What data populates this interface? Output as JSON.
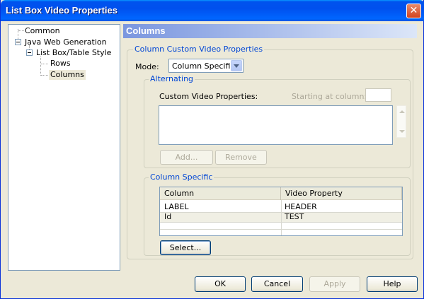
{
  "window": {
    "title": "List Box Video Properties",
    "close_glyph": "✕"
  },
  "tree": {
    "items": [
      {
        "label": "Common"
      },
      {
        "label": "Java Web Generation"
      },
      {
        "label": "List Box/Table Style"
      },
      {
        "label": "Rows"
      },
      {
        "label": "Columns",
        "selected": true
      }
    ]
  },
  "panel": {
    "title": "Columns",
    "custom_group": {
      "legend": "Column Custom Video Properties",
      "mode_label": "Mode:",
      "mode_value": "Column Specific",
      "alternating": {
        "legend": "Alternating",
        "custom_label": "Custom Video Properties:",
        "starting_label": "Starting at column:",
        "add_button": "Add...",
        "remove_button": "Remove"
      },
      "column_specific": {
        "legend": "Column Specific",
        "columns": [
          "Column",
          "Video Property"
        ],
        "rows": [
          [
            "LABEL",
            "HEADER"
          ],
          [
            "Id",
            "TEST"
          ]
        ],
        "select_button": "Select..."
      }
    }
  },
  "footer": {
    "ok": "OK",
    "cancel": "Cancel",
    "apply": "Apply",
    "help": "Help"
  },
  "colors": {
    "titlebar": "#0054e3",
    "group_label": "#0046d5",
    "window_bg": "#ece9d8"
  }
}
